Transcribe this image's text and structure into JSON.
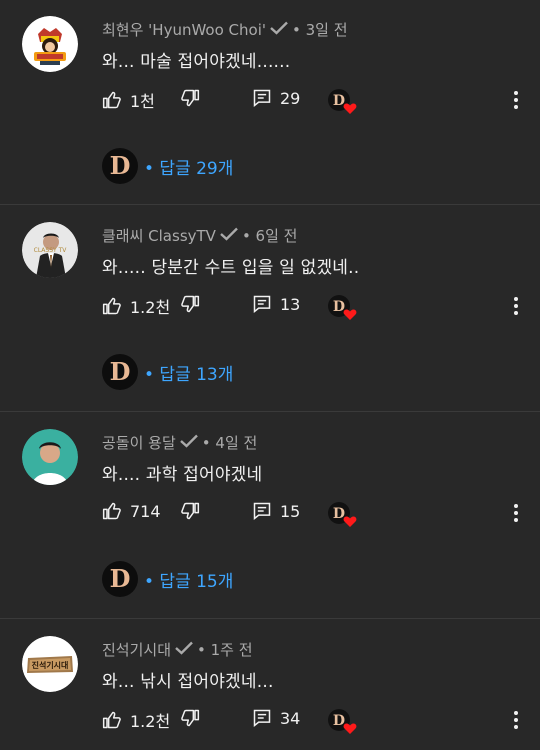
{
  "colors": {
    "background": "#282828",
    "link": "#3ea6ff",
    "heart": "#ff1a1a",
    "text": "#f1f1f1",
    "muted": "#aaaaaa"
  },
  "comments": [
    {
      "author": "최현우 'HyunWoo Choi'",
      "time": "• 3일 전",
      "text": "와... 마술 접어야겠네......",
      "likes": "1천",
      "replies_count": "29",
      "replies_label": "• 답글 29개",
      "avatar_icon": "badge-avatar"
    },
    {
      "author": "클래씨 ClassyTV",
      "time": "• 6일 전",
      "text": "와..... 당분간 수트 입을 일 없겠네..",
      "likes": "1.2천",
      "replies_count": "13",
      "replies_label": "• 답글 13개",
      "avatar_icon": "man-in-suit-avatar",
      "avatar_text": "CLASSY TV"
    },
    {
      "author": "공돌이 용달",
      "time": "• 4일 전",
      "text": "와.... 과학 접어야겠네",
      "likes": "714",
      "replies_count": "15",
      "replies_label": "• 답글 15개",
      "avatar_icon": "person-avatar"
    },
    {
      "author": "진석기시대",
      "time": "• 1주 전",
      "text": "와... 낚시 접어야겠네...",
      "likes": "1.2천",
      "replies_count": "34",
      "avatar_icon": "wood-sign-avatar",
      "avatar_text": "진석기시대"
    }
  ]
}
